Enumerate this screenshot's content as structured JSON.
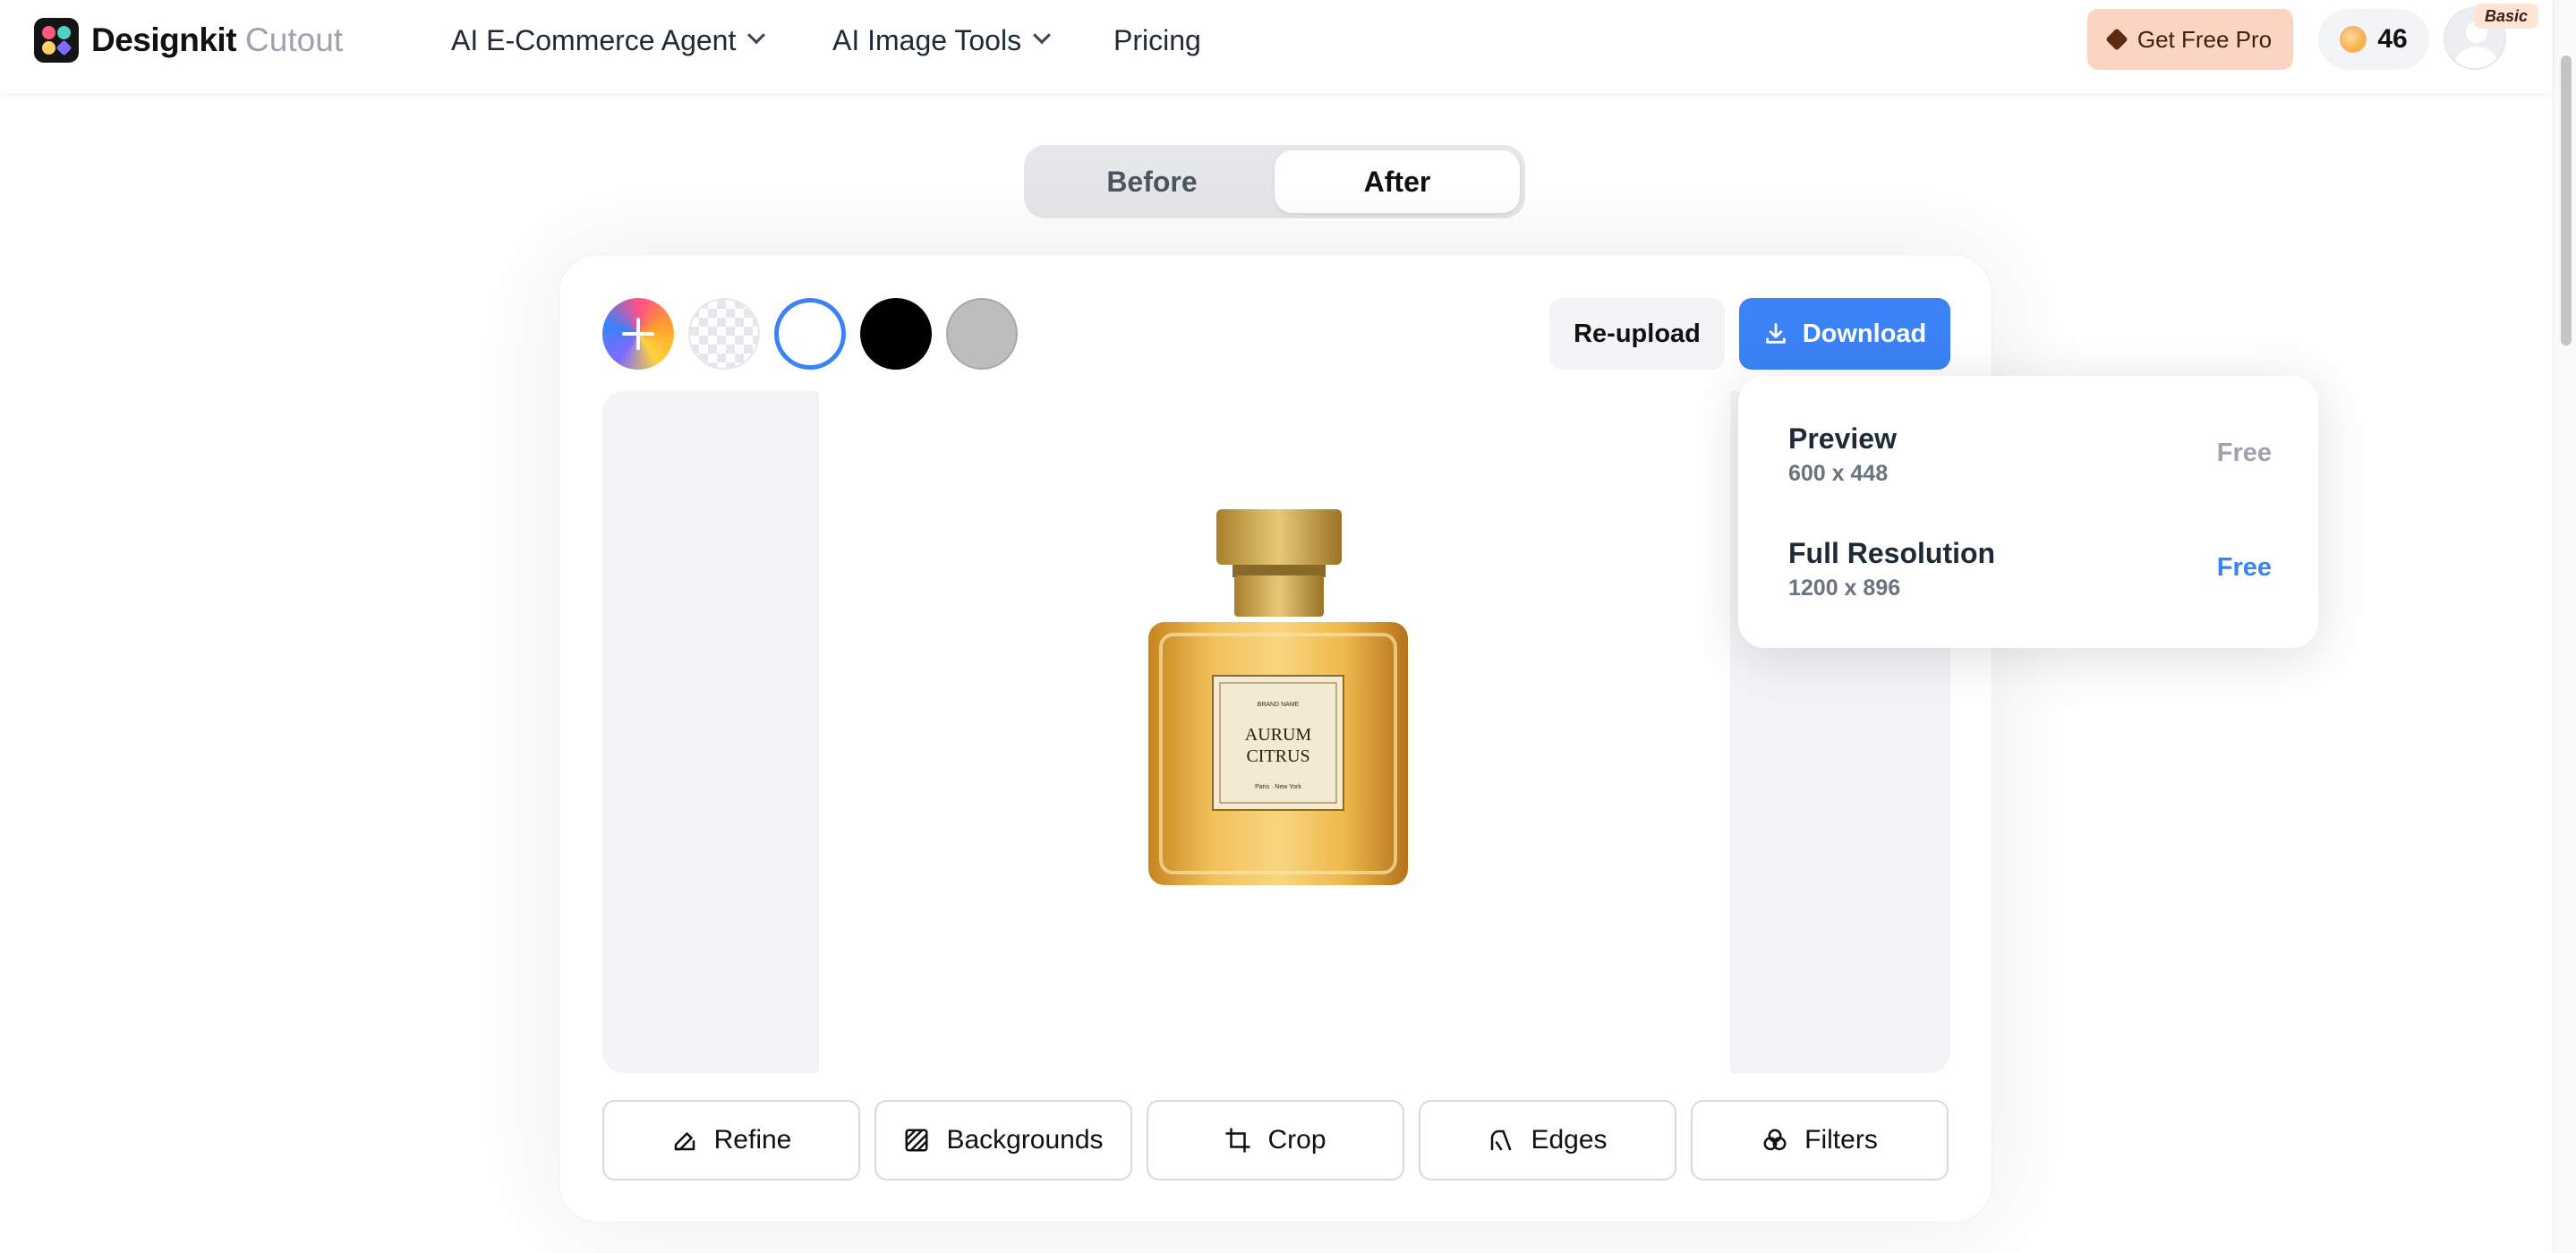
{
  "header": {
    "brand": "Designkit",
    "brand_sub": "Cutout",
    "nav": [
      {
        "label": "AI E-Commerce Agent",
        "has_dropdown": true
      },
      {
        "label": "AI Image Tools",
        "has_dropdown": true
      },
      {
        "label": "Pricing",
        "has_dropdown": false
      }
    ],
    "pro_button": "Get Free Pro",
    "credits": "46",
    "plan_badge": "Basic"
  },
  "view_toggle": {
    "options": [
      "Before",
      "After"
    ],
    "selected": "After"
  },
  "background_swatches": [
    {
      "name": "add-color",
      "color": "gradient"
    },
    {
      "name": "transparent",
      "color": "transparent"
    },
    {
      "name": "white",
      "color": "#ffffff",
      "selected": true
    },
    {
      "name": "black",
      "color": "#000000"
    },
    {
      "name": "gray",
      "color": "#bdbdbd"
    }
  ],
  "actions": {
    "reupload": "Re-upload",
    "download": "Download"
  },
  "product": {
    "label_line1": "AURUM",
    "label_line2": "CITRUS",
    "label_brand": "BRAND NAME",
    "label_footer": "Paris · New York"
  },
  "download_menu": [
    {
      "title": "Preview",
      "size": "600 x 448",
      "price": "Free",
      "price_color": "#9ca3af"
    },
    {
      "title": "Full Resolution",
      "size": "1200 x 896",
      "price": "Free",
      "price_color": "#3b82f6"
    }
  ],
  "tools": [
    {
      "label": "Refine",
      "icon": "edit-icon"
    },
    {
      "label": "Backgrounds",
      "icon": "pattern-icon"
    },
    {
      "label": "Crop",
      "icon": "crop-icon"
    },
    {
      "label": "Edges",
      "icon": "edges-icon"
    },
    {
      "label": "Filters",
      "icon": "filters-icon"
    }
  ],
  "colors": {
    "accent": "#3b82f6",
    "pro_bg": "#fbd5c1"
  }
}
